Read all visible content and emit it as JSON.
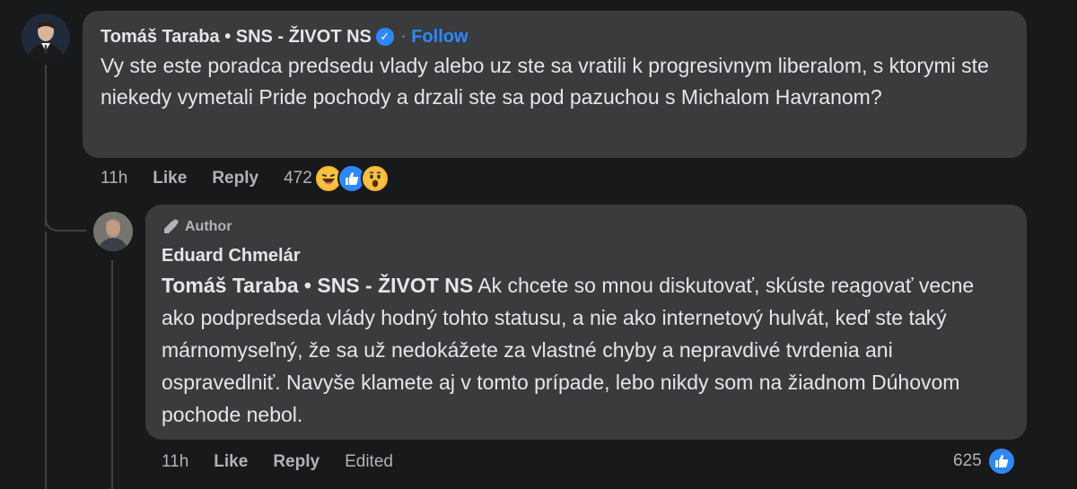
{
  "comment1": {
    "author": "Tomáš Taraba • SNS - ŽIVOT NS",
    "separator": "·",
    "follow_label": "Follow",
    "text": "Vy ste este poradca predsedu vlady alebo uz ste sa vratili k progresivnym liberalom, s ktorymi ste niekedy vymetali Pride pochody a drzali ste sa pod pazuchou s Michalom Havranom?",
    "time": "11h",
    "like_label": "Like",
    "reply_label": "Reply",
    "reaction_count": "472",
    "reactions": [
      "haha-icon",
      "like-icon",
      "wow-icon"
    ]
  },
  "comment2": {
    "badge": "Author",
    "author": "Eduard Chmelár",
    "mention": "Tomáš Taraba • SNS - ŽIVOT NS",
    "text": " Ak chcete so mnou diskutovať, skúste reagovať vecne ako podpredseda vlády hodný tohto statusu, a nie ako internetový hulvát, keď ste taký márnomyseľný, že sa už nedokážete za vlastné chyby a nepravdivé tvrdenia ani ospravedlniť. Navyše klamete aj v tomto prípade, lebo nikdy som na žiadnom Dúhovom pochode nebol.",
    "time": "11h",
    "like_label": "Like",
    "reply_label": "Reply",
    "edited_label": "Edited",
    "reaction_count": "625",
    "reactions": [
      "like-icon"
    ]
  },
  "colors": {
    "background": "#18191a",
    "bubble": "#3a3b3c",
    "accent": "#2d88ff",
    "secondary_text": "#b0b3b8"
  }
}
